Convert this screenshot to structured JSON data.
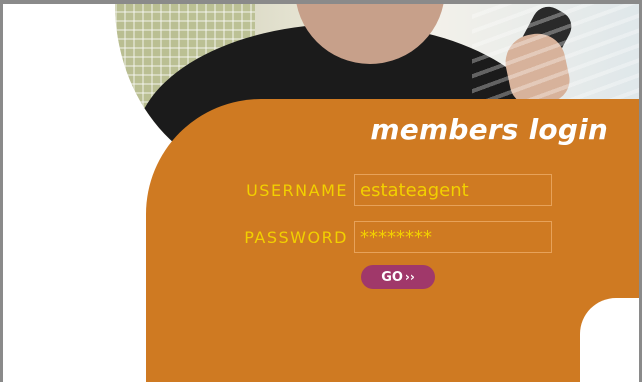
{
  "panel": {
    "title": "members login",
    "username": {
      "label": "USERNAME",
      "value": "estateagent"
    },
    "password": {
      "label": "PASSWORD",
      "value": "********"
    },
    "go_button": {
      "label": "GO",
      "icon": "double-chevron-right-icon",
      "color": "#a0386a"
    },
    "background_color": "#cf7a22",
    "label_color": "#f2d000"
  }
}
